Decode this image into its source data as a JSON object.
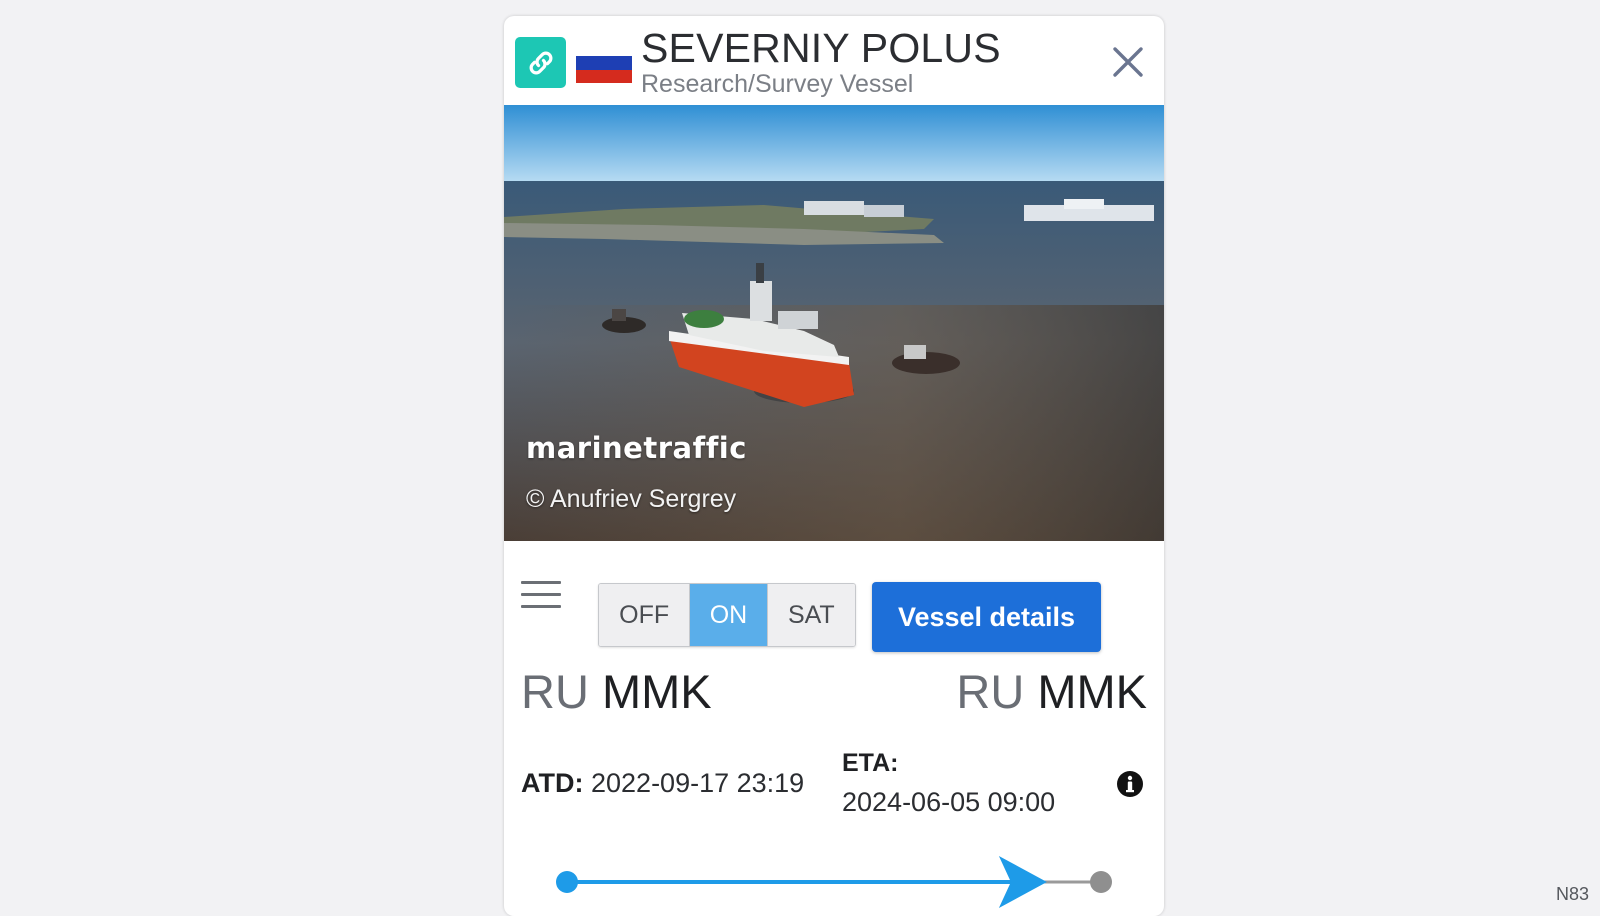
{
  "vessel": {
    "name": "SEVERNIY POLUS",
    "type": "Research/Survey Vessel",
    "flag_colors": [
      "#ffffff",
      "#1e3fb4",
      "#d52b1e"
    ]
  },
  "icons": {
    "link": "link-icon",
    "close": "close-icon",
    "menu": "hamburger-menu-icon",
    "info": "info-icon"
  },
  "photo": {
    "watermark": "marinetraffic",
    "credit": "© Anufriev Sergrey"
  },
  "toolbar": {
    "modes": [
      "OFF",
      "ON",
      "SAT"
    ],
    "active_mode": "ON",
    "details_label": "Vessel details"
  },
  "voyage": {
    "from": {
      "country": "RU",
      "port": "MMK"
    },
    "to": {
      "country": "RU",
      "port": "MMK"
    },
    "atd_label": "ATD:",
    "atd_value": "2022-09-17 23:19",
    "eta_label": "ETA:",
    "eta_value": "2024-06-05 09:00",
    "progress": 0.85
  },
  "map_overlay": {
    "corner_text": "N83"
  },
  "colors": {
    "accent_blue": "#1d6fd9",
    "toggle_active": "#5aaeea",
    "link_teal": "#1dc7b4",
    "route_line": "#1e9be8"
  }
}
